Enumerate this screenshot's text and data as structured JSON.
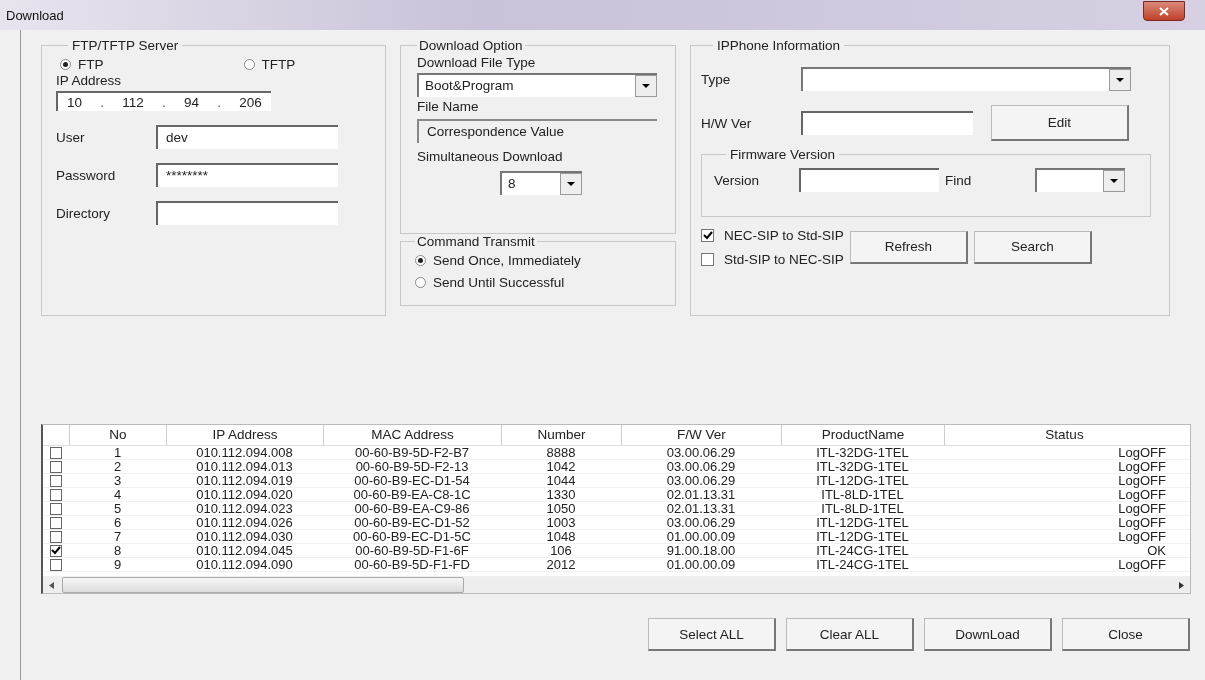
{
  "window": {
    "title": "Download"
  },
  "server": {
    "title": "FTP/TFTP Server",
    "protocols": [
      {
        "label": "FTP",
        "selected": true
      },
      {
        "label": "TFTP",
        "selected": false
      }
    ],
    "ip_label": "IP Address",
    "ip": [
      "10",
      "112",
      "94",
      "206"
    ],
    "ip_separator": ".",
    "fields": [
      {
        "label": "User",
        "value": "dev"
      },
      {
        "label": "Password",
        "value": "********"
      },
      {
        "label": "Directory"
      }
    ]
  },
  "download_option": {
    "title": "Download Option",
    "file_type_label": "Download File Type",
    "file_type": "Boot&Program",
    "file_name_label": "File Name",
    "file_name": "Correspondence Value",
    "simultaneous_label": "Simultaneous Download",
    "simultaneous": "8"
  },
  "command_transmit": {
    "title": "Command Transmit",
    "options": [
      {
        "label": "Send Once, Immediately",
        "selected": true
      },
      {
        "label": "Send Until Successful",
        "selected": false
      }
    ]
  },
  "ipphone": {
    "title": "IPPhone Information",
    "type_label": "Type",
    "hw_label": "H/W Ver",
    "edit_button": "Edit",
    "firmware": {
      "title": "Firmware Version",
      "version_label": "Version",
      "find_label": "Find"
    },
    "conversions": [
      {
        "label": "NEC-SIP to Std-SIP",
        "checked": true
      },
      {
        "label": "Std-SIP to NEC-SIP",
        "checked": false
      }
    ],
    "buttons": [
      "Refresh",
      "Search"
    ]
  },
  "table": {
    "columns": [
      "No",
      "IP Address",
      "MAC Address",
      "Number",
      "F/W Ver",
      "ProductName",
      "Status"
    ],
    "rows": [
      {
        "checked": false,
        "cells": [
          "1",
          "010.112.094.008",
          "00-60-B9-5D-F2-B7",
          "8888",
          "03.00.06.29",
          "ITL-32DG-1TEL",
          "LogOFF"
        ]
      },
      {
        "checked": false,
        "cells": [
          "2",
          "010.112.094.013",
          "00-60-B9-5D-F2-13",
          "1042",
          "03.00.06.29",
          "ITL-32DG-1TEL",
          "LogOFF"
        ]
      },
      {
        "checked": false,
        "cells": [
          "3",
          "010.112.094.019",
          "00-60-B9-EC-D1-54",
          "1044",
          "03.00.06.29",
          "ITL-12DG-1TEL",
          "LogOFF"
        ]
      },
      {
        "checked": false,
        "cells": [
          "4",
          "010.112.094.020",
          "00-60-B9-EA-C8-1C",
          "1330",
          "02.01.13.31",
          "ITL-8LD-1TEL",
          "LogOFF"
        ]
      },
      {
        "checked": false,
        "cells": [
          "5",
          "010.112.094.023",
          "00-60-B9-EA-C9-86",
          "1050",
          "02.01.13.31",
          "ITL-8LD-1TEL",
          "LogOFF"
        ]
      },
      {
        "checked": false,
        "cells": [
          "6",
          "010.112.094.026",
          "00-60-B9-EC-D1-52",
          "1003",
          "03.00.06.29",
          "ITL-12DG-1TEL",
          "LogOFF"
        ]
      },
      {
        "checked": false,
        "cells": [
          "7",
          "010.112.094.030",
          "00-60-B9-EC-D1-5C",
          "1048",
          "01.00.00.09",
          "ITL-12DG-1TEL",
          "LogOFF"
        ]
      },
      {
        "checked": true,
        "cells": [
          "8",
          "010.112.094.045",
          "00-60-B9-5D-F1-6F",
          "106",
          "91.00.18.00",
          "ITL-24CG-1TEL",
          "OK"
        ]
      },
      {
        "checked": false,
        "cells": [
          "9",
          "010.112.094.090",
          "00-60-B9-5D-F1-FD",
          "2012",
          "01.00.00.09",
          "ITL-24CG-1TEL",
          "LogOFF"
        ]
      }
    ]
  },
  "buttons": [
    "Select ALL",
    "Clear ALL",
    "DownLoad",
    "Close"
  ]
}
